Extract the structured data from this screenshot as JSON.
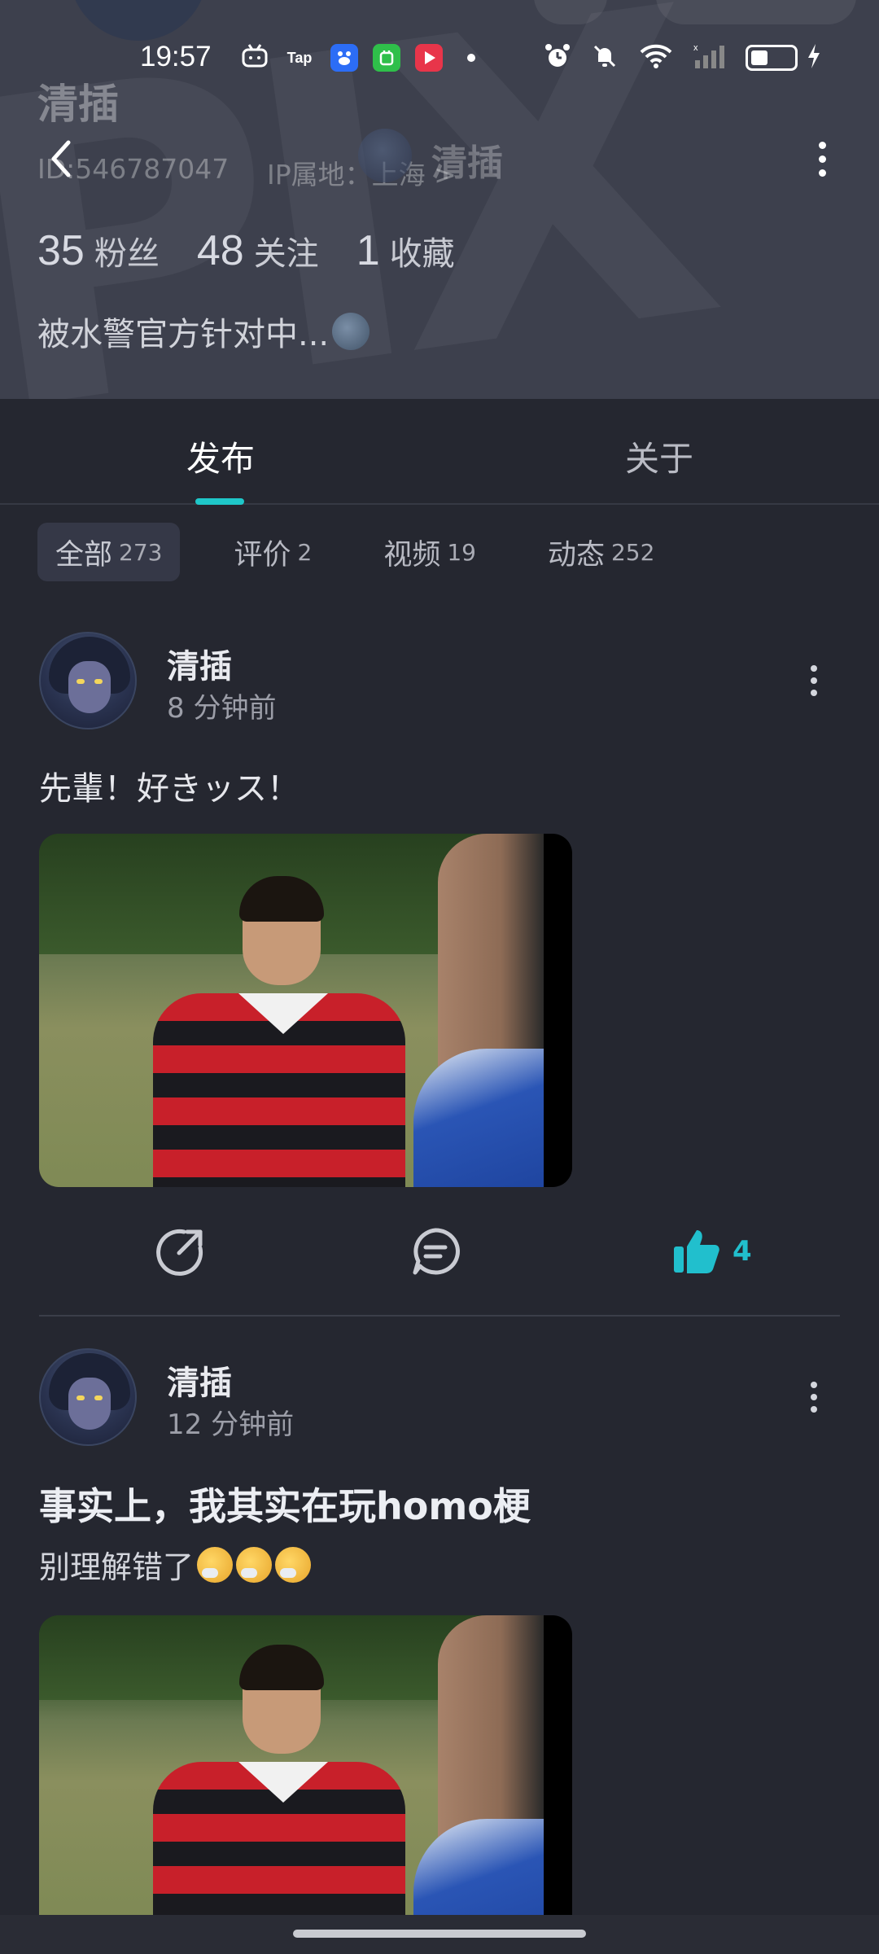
{
  "status_bar": {
    "time": "19:57",
    "app_icons": [
      "bilibili-tv-icon",
      "tap-icon",
      "baidu-icon",
      "green-app-icon",
      "red-play-icon"
    ],
    "tap_label": "Tap",
    "right_icons": [
      "alarm-icon",
      "mute-icon",
      "wifi-icon",
      "signal-icon",
      "battery-icon",
      "charging-icon"
    ]
  },
  "profile": {
    "nav_name": "清插",
    "name": "清插",
    "id": "ID:546787047",
    "ip": "IP属地：上海 >",
    "stats": [
      {
        "num": "35",
        "label": "粉丝"
      },
      {
        "num": "48",
        "label": "关注"
      },
      {
        "num": "1",
        "label": "收藏"
      }
    ],
    "bio": "被水警官方针对中..."
  },
  "tabs": [
    {
      "label": "发布",
      "active": true
    },
    {
      "label": "关于",
      "active": false
    }
  ],
  "filters": [
    {
      "label": "全部",
      "count": "273",
      "active": true
    },
    {
      "label": "评价",
      "count": "2",
      "active": false
    },
    {
      "label": "视频",
      "count": "19",
      "active": false
    },
    {
      "label": "动态",
      "count": "252",
      "active": false
    }
  ],
  "posts": [
    {
      "author": "清插",
      "time": "8 分钟前",
      "text": "先輩！好きッス！",
      "likes": "4"
    },
    {
      "author": "清插",
      "time": "12 分钟前",
      "title": "事实上，我其实在玩homo梗",
      "subtitle": "别理解错了"
    }
  ],
  "colors": {
    "accent": "#1fc7c9",
    "like": "#21bfcd",
    "background": "#252730",
    "header": "#3d404d"
  }
}
